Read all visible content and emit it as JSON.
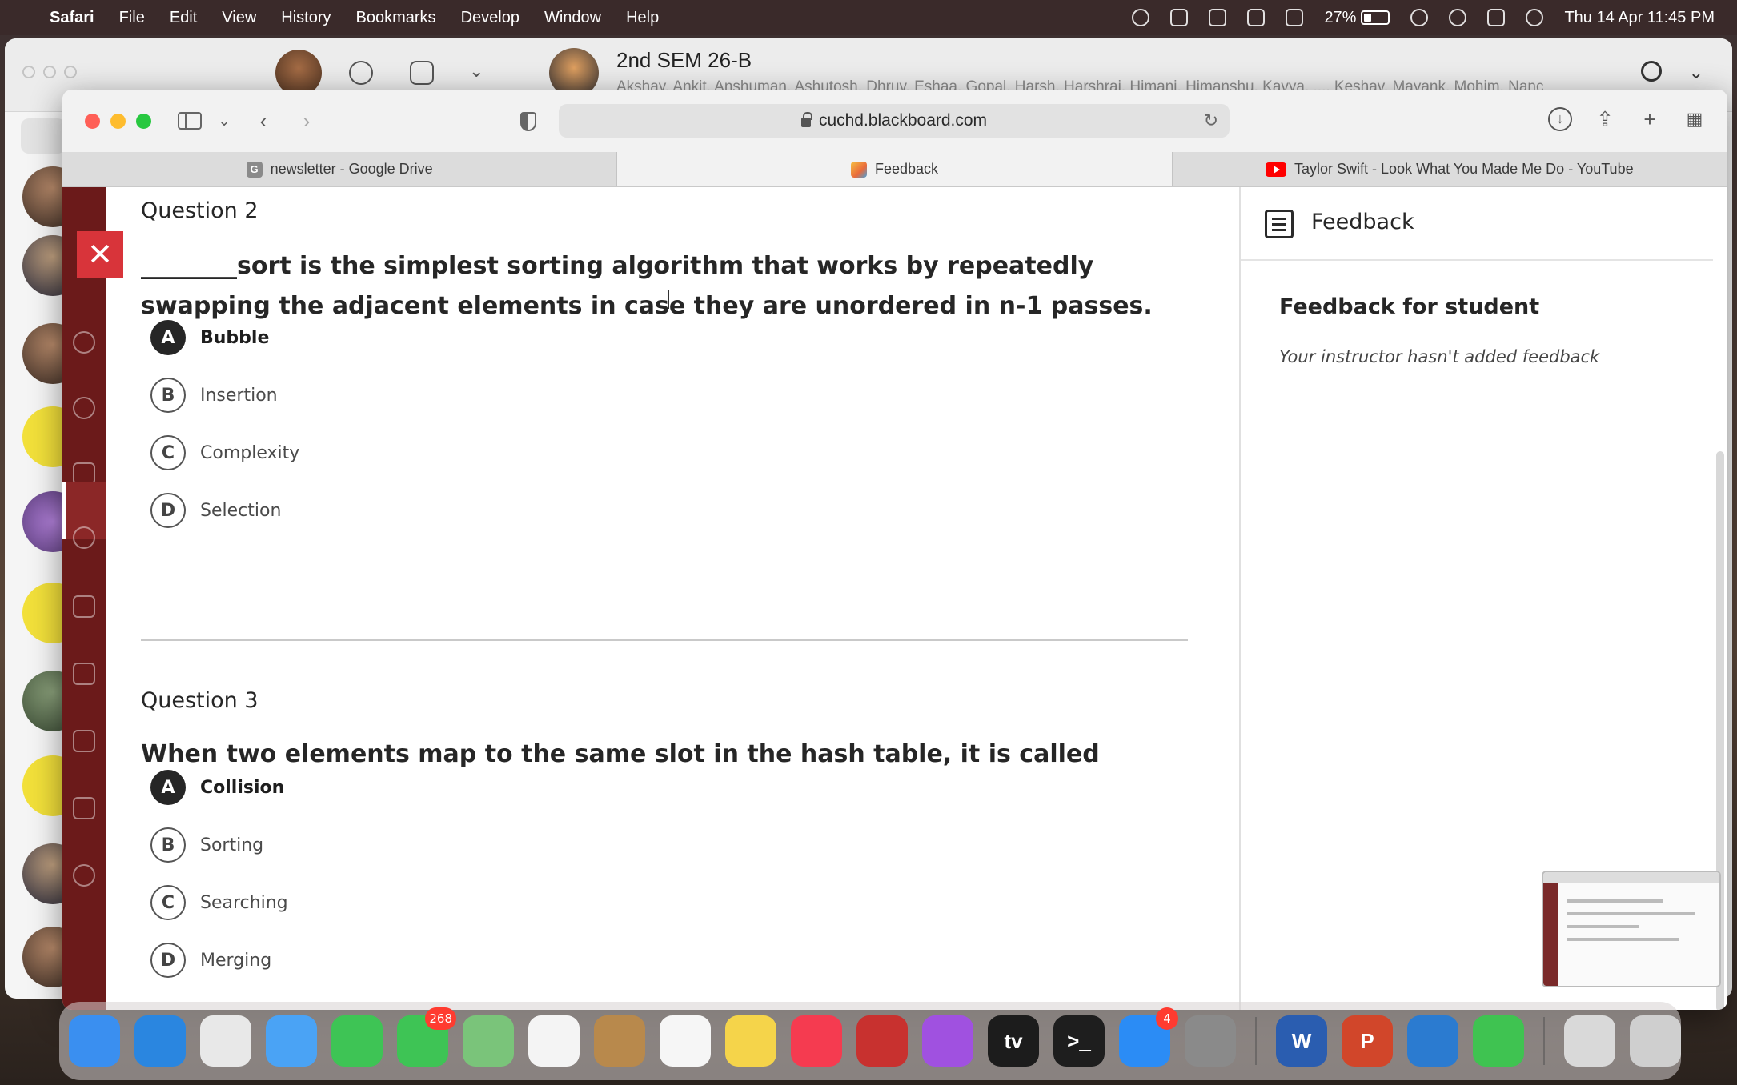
{
  "menubar": {
    "app_name": "Safari",
    "menus": [
      "File",
      "Edit",
      "View",
      "History",
      "Bookmarks",
      "Develop",
      "Window",
      "Help"
    ],
    "battery_pct": "27%",
    "datetime": "Thu 14 Apr  11:45 PM"
  },
  "bg_chat": {
    "group_title": "2nd SEM 26-B",
    "group_members": "Akshay, Ankit, Anshuman, Ashutosh, Dhruv, Eshaa, Gopal, Harsh, Harshraj, Himani, Himanshu, Kavya, ..., Keshav, Mayank, Mohim, Nanc"
  },
  "safari": {
    "address": "cuchd.blackboard.com",
    "tabs": [
      {
        "label": "newsletter - Google Drive",
        "favicon": "G"
      },
      {
        "label": "Feedback"
      },
      {
        "label": "Taylor Swift - Look What You Made Me Do - YouTube"
      }
    ]
  },
  "quiz": {
    "close_glyph": "✕",
    "questions": [
      {
        "label": "Question 2",
        "text": "________sort is the simplest sorting algorithm that works by repeatedly swapping the adjacent elements in case they are unordered in n-1 passes.",
        "options": [
          {
            "letter": "A",
            "text": "Bubble",
            "selected": true
          },
          {
            "letter": "B",
            "text": "Insertion",
            "selected": false
          },
          {
            "letter": "C",
            "text": "Complexity",
            "selected": false
          },
          {
            "letter": "D",
            "text": "Selection",
            "selected": false
          }
        ]
      },
      {
        "label": "Question 3",
        "text": "When two elements map to the same slot in the hash table, it is called",
        "options": [
          {
            "letter": "A",
            "text": "Collision",
            "selected": true
          },
          {
            "letter": "B",
            "text": "Sorting",
            "selected": false
          },
          {
            "letter": "C",
            "text": "Searching",
            "selected": false
          },
          {
            "letter": "D",
            "text": "Merging",
            "selected": false
          }
        ]
      }
    ]
  },
  "feedback": {
    "header": "Feedback",
    "subheading": "Feedback for student",
    "note": "Your instructor hasn't added feedback"
  },
  "dock": {
    "apps": [
      {
        "name": "Finder",
        "color": "#3a8ff0"
      },
      {
        "name": "Safari",
        "color": "#2a86e0"
      },
      {
        "name": "Chrome",
        "color": "#e8e8e8"
      },
      {
        "name": "Mail",
        "color": "#4aa3f5"
      },
      {
        "name": "FaceTime",
        "color": "#3ec455"
      },
      {
        "name": "Messages",
        "color": "#3ec455",
        "badge": "268"
      },
      {
        "name": "Maps",
        "color": "#7ac47a"
      },
      {
        "name": "Photos",
        "color": "#f4f4f4"
      },
      {
        "name": "Contacts",
        "color": "#b8894c"
      },
      {
        "name": "Reminders",
        "color": "#f6f6f6"
      },
      {
        "name": "Notes",
        "color": "#f5d44a"
      },
      {
        "name": "Music",
        "color": "#f53b50"
      },
      {
        "name": "Photo Booth",
        "color": "#c8312f"
      },
      {
        "name": "Podcasts",
        "color": "#a051e0"
      },
      {
        "name": "TV",
        "color": "#1c1c1c",
        "glyph": "tv"
      },
      {
        "name": "Terminal",
        "color": "#1e1e1e",
        "glyph": ">_"
      },
      {
        "name": "App Store",
        "color": "#2b8cf5",
        "badge": "4"
      },
      {
        "name": "System Preferences",
        "color": "#8a8a8a"
      },
      {
        "name": "Word",
        "color": "#2a5db0",
        "glyph": "W"
      },
      {
        "name": "PowerPoint",
        "color": "#d1462a",
        "glyph": "P"
      },
      {
        "name": "VS Code",
        "color": "#2b7bd0"
      },
      {
        "name": "WhatsApp",
        "color": "#3fc351"
      },
      {
        "name": "Downloads",
        "color": "#d9d9d9"
      },
      {
        "name": "Trash",
        "color": "#cfcfcf"
      }
    ]
  }
}
